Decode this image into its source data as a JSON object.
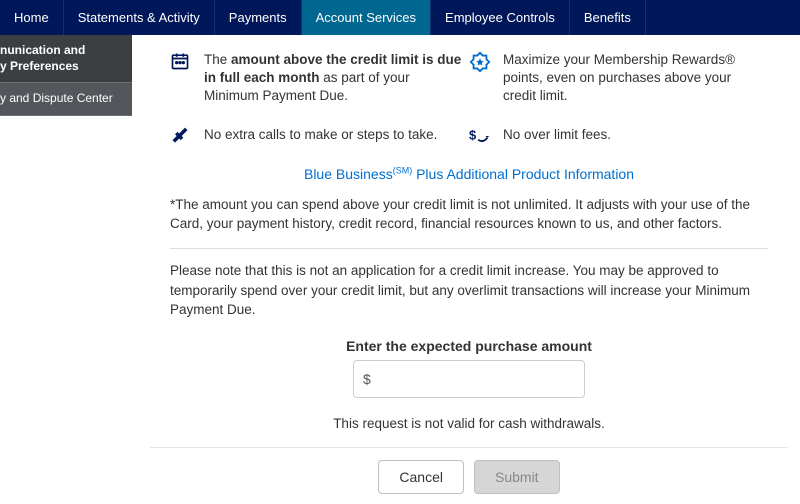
{
  "nav": {
    "tabs": [
      {
        "label": "Home"
      },
      {
        "label": "Statements & Activity"
      },
      {
        "label": "Payments"
      },
      {
        "label": "Account Services"
      },
      {
        "label": "Employee Controls"
      },
      {
        "label": "Benefits"
      }
    ],
    "active_index": 3
  },
  "sidenav": {
    "items": [
      {
        "line1": "nunication and",
        "line2": "y Preferences",
        "active": true
      },
      {
        "line1": "y and Dispute Center",
        "line2": "",
        "active": false
      }
    ]
  },
  "benefits": {
    "b0": {
      "bold": "amount above the credit limit is due in full each month",
      "pre": "The ",
      "post": " as part of your Minimum Payment Due."
    },
    "b1": "Maximize your Membership Rewards® points, even on purchases above your credit limit.",
    "b2": "No extra calls to make or steps to take.",
    "b3": "No over limit fees."
  },
  "link": {
    "pre": "Blue Business",
    "sup": "(SM)",
    "post": " Plus Additional Product Information"
  },
  "disclaimer": "*The amount you can spend above your credit limit is not unlimited. It adjusts with your use of the Card, your payment history, credit record, financial resources known to us, and other factors.",
  "note": "Please note that this is not an application for a credit limit increase. You may be approved to temporarily spend over your credit limit, but any overlimit transactions will increase your Minimum Payment Due.",
  "form": {
    "label": "Enter the expected purchase amount",
    "currency": "$",
    "value": "",
    "cash_note": "This request is not valid for cash withdrawals."
  },
  "buttons": {
    "cancel": "Cancel",
    "submit": "Submit"
  }
}
